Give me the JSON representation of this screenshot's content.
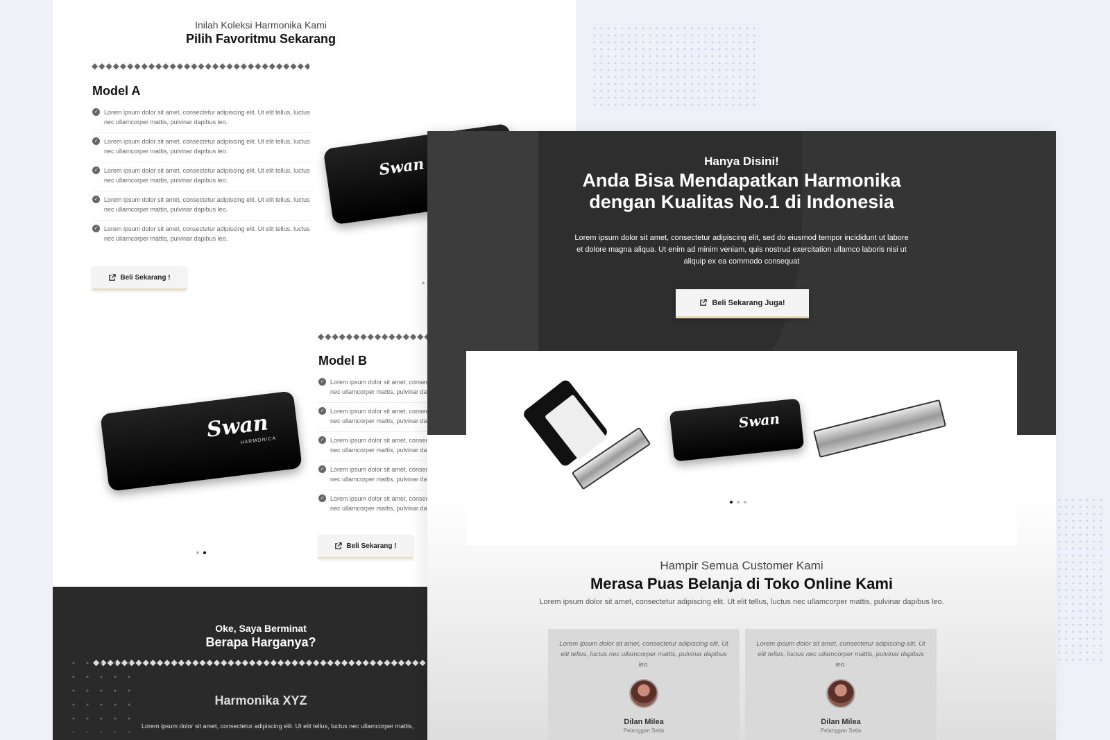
{
  "left_page": {
    "header": {
      "subtitle": "Inilah Koleksi Harmonika Kami",
      "title": "Pilih Favoritmu Sekarang"
    },
    "divider": "◆◆◆◆◆◆◆◆◆◆◆◆◆◆◆◆◆◆◆◆◆◆◆◆◆◆◆◆◆◆◆◆◆◆◆◆◆◆◆◆◆◆◆◆◆◆◆◆◆◆◆◆◆◆◆◆◆◆◆◆◆◆◆◆◆◆◆◆◆◆◆◆◆◆◆◆◆◆◆◆",
    "model_a": {
      "title": "Model A",
      "features": [
        "Lorem ipsum dolor sit amet, consectetur adipiscing elit. Ut elit tellus, luctus nec ullamcorper mattis, pulvinar dapibus leo.",
        "Lorem ipsum dolor sit amet, consectetur adipiscing elit. Ut elit tellus, luctus nec ullamcorper mattis, pulvinar dapibus leo.",
        "Lorem ipsum dolor sit amet, consectetur adipiscing elit. Ut elit tellus, luctus nec ullamcorper mattis, pulvinar dapibus leo.",
        "Lorem ipsum dolor sit amet, consectetur adipiscing elit. Ut elit tellus, luctus nec ullamcorper mattis, pulvinar dapibus leo.",
        "Lorem ipsum dolor sit amet, consectetur adipiscing elit. Ut elit tellus, luctus nec ullamcorper mattis, pulvinar dapibus leo."
      ],
      "button": "Beli Sekarang !"
    },
    "model_b": {
      "title": "Model B",
      "features": [
        "Lorem ipsum dolor sit amet, consectetur adipiscing elit. Ut elit tellus, luctus nec ullamcorper mattis, pulvinar dapibus leo.",
        "Lorem ipsum dolor sit amet, consectetur adipiscing elit. Ut elit tellus, luctus nec ullamcorper mattis, pulvinar dapibus leo.",
        "Lorem ipsum dolor sit amet, consectetur adipiscing elit. Ut elit tellus, luctus nec ullamcorper mattis, pulvinar dapibus leo.",
        "Lorem ipsum dolor sit amet, consectetur adipiscing elit. Ut elit tellus, luctus nec ullamcorper mattis, pulvinar dapibus leo.",
        "Lorem ipsum dolor sit amet, consectetur adipiscing elit. Ut elit tellus, luctus nec ullamcorper mattis, pulvinar dapibus leo."
      ],
      "button": "Beli Sekarang !"
    },
    "case_brand": "Swan",
    "case_sub": "HARMONICA",
    "pricing": {
      "kicker": "Oke, Saya Berminat",
      "title": "Berapa Harganya?",
      "product": "Harmonika XYZ",
      "desc": "Lorem ipsum dolor sit amet, consectetur adipiscing elit. Ut elit tellus, luctus nec ullamcorper mattis,"
    }
  },
  "right_page": {
    "hero": {
      "kicker": "Hanya Disini!",
      "title_line1": "Anda Bisa Mendapatkan Harmonika",
      "title_line2": "dengan Kualitas No.1 di Indonesia",
      "desc": "Lorem ipsum dolor sit amet, consectetur adipiscing elit, sed do eiusmod tempor incididunt ut labore et dolore magna aliqua. Ut enim ad minim veniam, quis nostrud exercitation ullamco laboris nisi ut aliquip ex ea commodo consequat",
      "button": "Beli Sekarang Juga!"
    },
    "testimonials_section": {
      "subtitle": "Hampir Semua Customer Kami",
      "title": "Merasa Puas Belanja di Toko Online Kami",
      "desc": "Lorem ipsum dolor sit amet, consectetur adipiscing elit. Ut elit tellus, luctus nec ullamcorper mattis, pulvinar dapibus leo.",
      "items": [
        {
          "quote": "Lorem ipsum dolor sit amet, consectetur adipiscing elit. Ut elit tellus, luctus nec ullamcorper mattis, pulvinar dapibus leo.",
          "name": "Dilan Milea",
          "role": "Pelanggan Setia"
        },
        {
          "quote": "Lorem ipsum dolor sit amet, consectetur adipiscing elit. Ut elit tellus, luctus nec ullamcorper mattis, pulvinar dapibus leo.",
          "name": "Dilan Milea",
          "role": "Pelanggan Setia"
        }
      ]
    }
  },
  "icons": {
    "check": "check-circle-icon",
    "external": "external-link-icon"
  },
  "colors": {
    "dark": "#353535",
    "button_accent": "#e8d9b5",
    "background": "#eef2f8"
  }
}
